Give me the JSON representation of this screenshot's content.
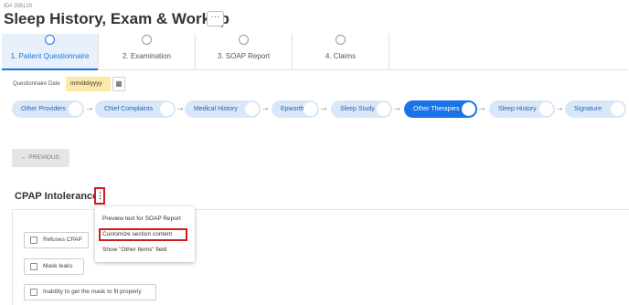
{
  "record_id": "ID# 356120",
  "title": "Sleep History, Exam & Workup",
  "title_more": "···",
  "steps": [
    {
      "label": "1. Patient Questionnaire",
      "active": true
    },
    {
      "label": "2. Examination",
      "active": false
    },
    {
      "label": "3. SOAP Report",
      "active": false
    },
    {
      "label": "4. Claims",
      "active": false
    }
  ],
  "questionnaire_date": {
    "label": "Questionnaire Date",
    "placeholder": "mm/dd/yyyy"
  },
  "sections": [
    {
      "label": "Other Providers",
      "selected": false
    },
    {
      "label": "Chief Complaints",
      "selected": false
    },
    {
      "label": "Medical History",
      "selected": false
    },
    {
      "label": "Epworth",
      "selected": false
    },
    {
      "label": "Sleep Study",
      "selected": false
    },
    {
      "label": "Other Therapies",
      "selected": true
    },
    {
      "label": "Sleep History",
      "selected": false
    },
    {
      "label": "Signature",
      "selected": false
    }
  ],
  "arrow_glyph": "→",
  "previous_button": "← PREVIOUS",
  "section_heading": "CPAP Intolerance",
  "kebab_glyph": "⋮",
  "context_menu": [
    "Preview text for SOAP Report",
    "Customize section content",
    "Show \"Other Items\" field"
  ],
  "checkbox_items": [
    "Refuses CPAP",
    "Mask leaks",
    "Inability to get the mask to fit properly"
  ],
  "colors": {
    "accent": "#1a73e8",
    "highlight_border": "#d01c1c",
    "date_field": "#fde9a8"
  }
}
